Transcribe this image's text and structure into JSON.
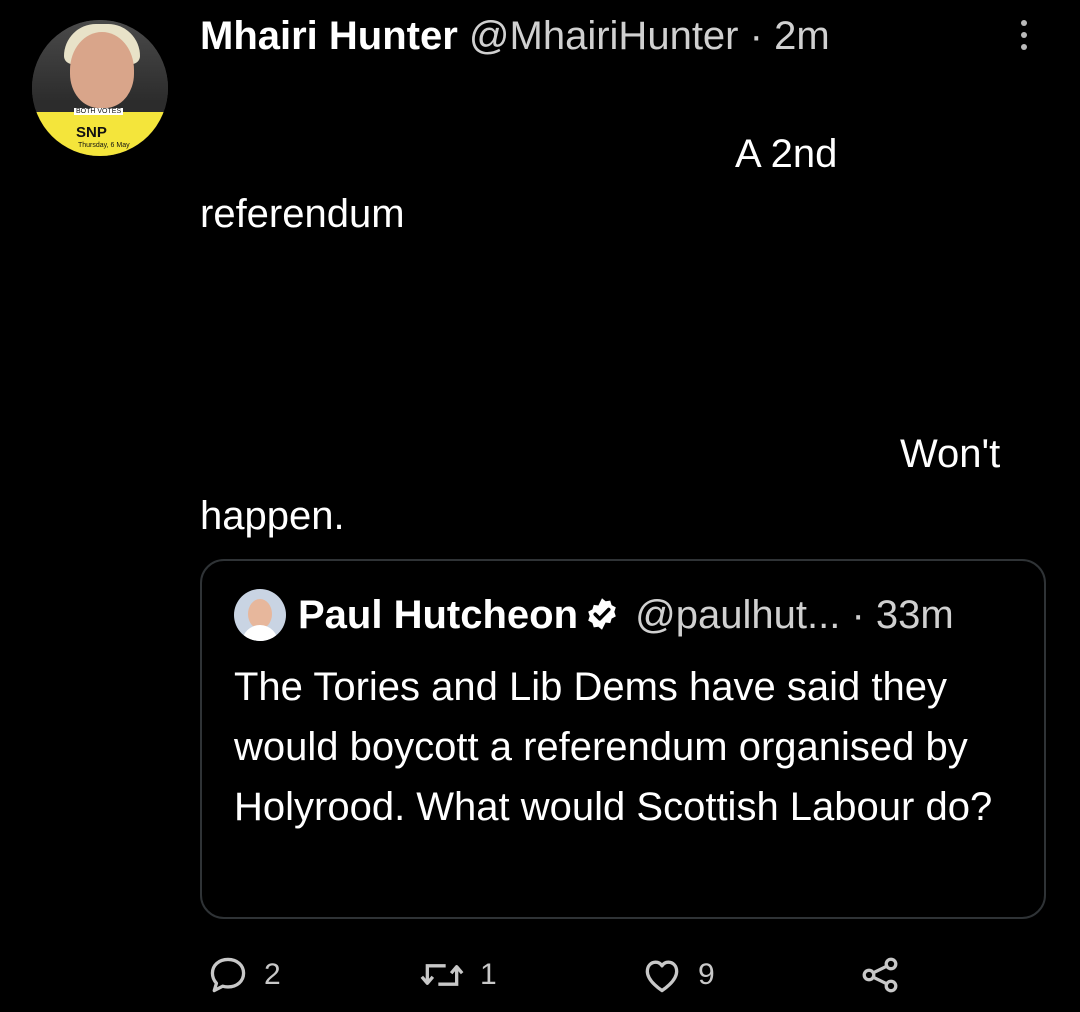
{
  "tweet": {
    "author_name": "Mhairi Hunter",
    "handle": "@MhairiHunter",
    "separator": "·",
    "time": "2m",
    "text_line1": "A 2nd",
    "text_line2": "referendum",
    "text_line3": "Won't",
    "text_line4": "happen.",
    "avatar_badge": {
      "top": "BOTH VOTES",
      "main": "SNP",
      "sub": "Thursday, 6 May"
    }
  },
  "quoted_tweet": {
    "author_name": "Paul Hutcheon",
    "handle": "@paulhut...",
    "separator": "·",
    "time": "33m",
    "text": "The Tories and Lib Dems have said they would boycott a referendum organised by Holyrood. What would Scottish Labour do?"
  },
  "actions": {
    "replies": "2",
    "retweets": "1",
    "likes": "9"
  },
  "colors": {
    "background": "#000000",
    "text": "#ffffff",
    "muted": "#c8c8c8",
    "border": "#2f3336"
  }
}
